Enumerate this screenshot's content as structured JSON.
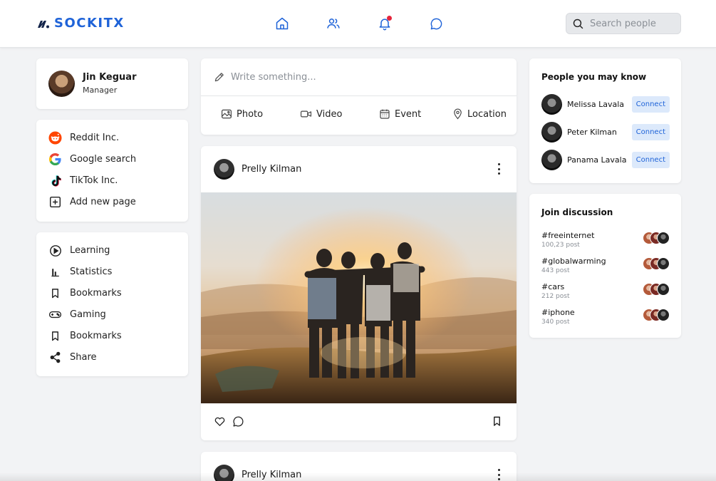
{
  "header": {
    "brand": "SOCKITX",
    "brand_color": "#1f63d8",
    "nav": [
      {
        "name": "home",
        "icon": "home-icon"
      },
      {
        "name": "friends",
        "icon": "users-icon"
      },
      {
        "name": "notifications",
        "icon": "bell-icon",
        "has_badge": true
      },
      {
        "name": "messages",
        "icon": "chat-bubble-icon"
      }
    ],
    "search_placeholder": "Search people"
  },
  "profile": {
    "name": "Jin Keguar",
    "role": "Manager"
  },
  "pages": [
    {
      "label": "Reddit Inc.",
      "icon": "reddit-icon"
    },
    {
      "label": "Google search",
      "icon": "google-icon"
    },
    {
      "label": "TikTok Inc.",
      "icon": "tiktok-icon"
    },
    {
      "label": "Add new page",
      "icon": "plus-square-icon"
    }
  ],
  "menu": [
    {
      "label": "Learning",
      "icon": "play-circle-icon"
    },
    {
      "label": "Statistics",
      "icon": "bar-chart-icon"
    },
    {
      "label": "Bookmarks",
      "icon": "bookmark-icon"
    },
    {
      "label": "Gaming",
      "icon": "gamepad-icon"
    },
    {
      "label": "Bookmarks",
      "icon": "bookmark-icon"
    },
    {
      "label": "Share",
      "icon": "share-icon"
    }
  ],
  "composer": {
    "placeholder": "Write something...",
    "actions": [
      {
        "label": "Photo",
        "icon": "image-icon"
      },
      {
        "label": "Video",
        "icon": "video-icon"
      },
      {
        "label": "Event",
        "icon": "calendar-icon"
      },
      {
        "label": "Location",
        "icon": "location-pin-icon"
      }
    ]
  },
  "posts": [
    {
      "author": "Prelly Kilman"
    },
    {
      "author": "Prelly Kilman"
    }
  ],
  "suggestions": {
    "title": "People you may know",
    "connect_label": "Connect",
    "people": [
      {
        "name": "Melissa Lavala"
      },
      {
        "name": "Peter Kilman"
      },
      {
        "name": "Panama Lavala"
      }
    ]
  },
  "discussion": {
    "title": "Join discussion",
    "topics": [
      {
        "tag": "#freeinternet",
        "count": "100,23 post"
      },
      {
        "tag": "#globalwarming",
        "count": "443 post"
      },
      {
        "tag": "#cars",
        "count": "212 post"
      },
      {
        "tag": "#iphone",
        "count": "340 post"
      }
    ]
  }
}
